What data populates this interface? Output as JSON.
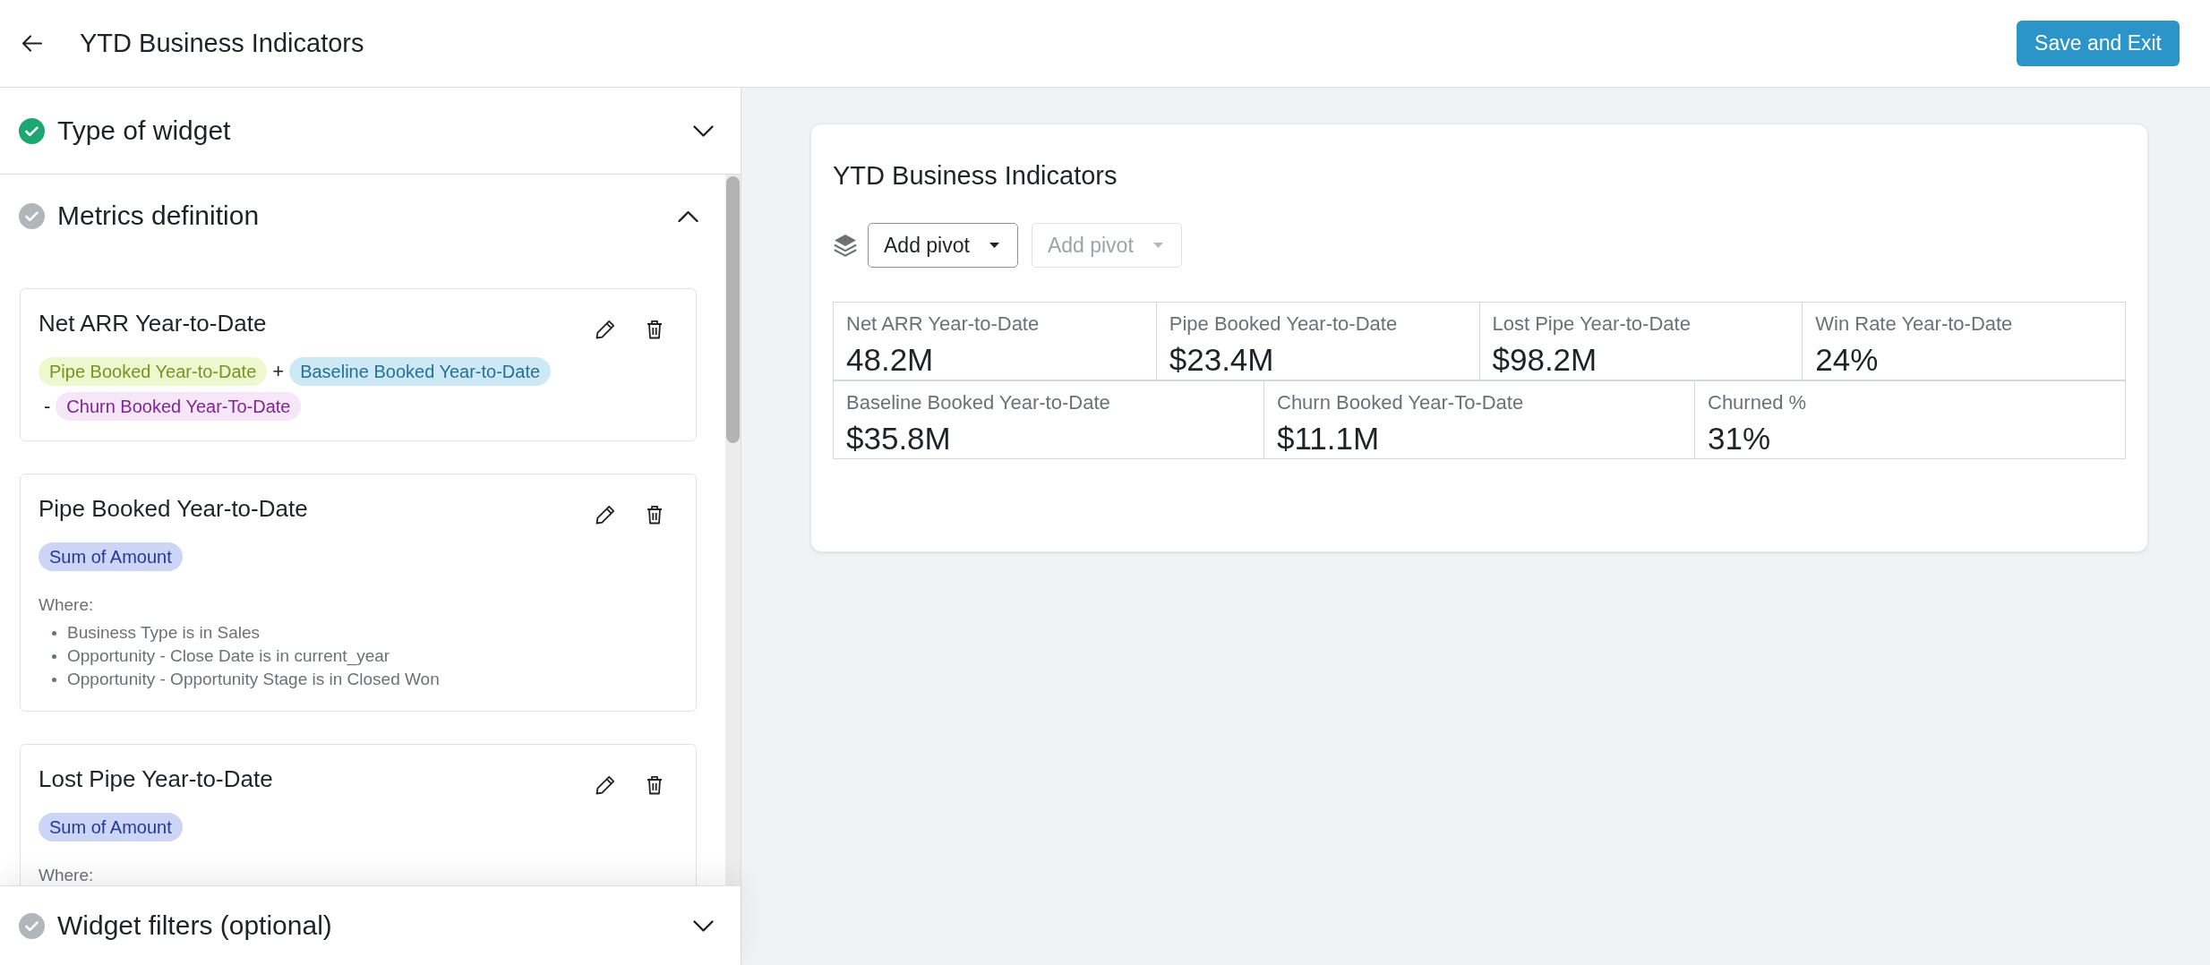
{
  "header": {
    "title": "YTD Business Indicators",
    "save_button": "Save and Exit"
  },
  "sections": [
    {
      "title": "Type of widget",
      "done": true,
      "expanded": false
    },
    {
      "title": "Metrics definition",
      "done": false,
      "expanded": true,
      "metrics": [
        {
          "name": "Net ARR Year-to-Date",
          "terms": [
            {
              "kind": "metric",
              "label": "Pipe Booked Year-to-Date",
              "color": "#eef8cf"
            },
            {
              "kind": "operator",
              "label": "+"
            },
            {
              "kind": "metric",
              "label": "Baseline Booked Year-to-Date",
              "color": "#cde9f6"
            },
            {
              "kind": "operator",
              "label": "-"
            },
            {
              "kind": "metric",
              "label": "Churn Booked Year-To-Date",
              "color": "#f5e6f8"
            }
          ]
        },
        {
          "name": "Pipe Booked Year-to-Date",
          "terms": [
            {
              "kind": "aggregation",
              "label": "Sum of Amount",
              "color": "#cdd5f7"
            }
          ],
          "where": {
            "label": "Where:",
            "conditions": [
              "Business Type is in Sales",
              "Opportunity - Close Date is in current_year",
              "Opportunity - Opportunity Stage is in Closed Won"
            ]
          }
        },
        {
          "name": "Lost Pipe Year-to-Date",
          "terms": [
            {
              "kind": "aggregation",
              "label": "Sum of Amount",
              "color": "#cdd5f7"
            }
          ],
          "where": {
            "label": "Where:"
          }
        }
      ]
    },
    {
      "title": "Widget filters (optional)",
      "done": false,
      "expanded": false
    }
  ],
  "preview": {
    "title": "YTD Business Indicators",
    "pivots": [
      {
        "label": "Add pivot",
        "disabled": false
      },
      {
        "label": "Add pivot",
        "disabled": true
      }
    ],
    "tile_rows": [
      [
        {
          "label": "Net ARR Year-to-Date",
          "value": "48.2M"
        },
        {
          "label": "Pipe Booked Year-to-Date",
          "value": "$23.4M"
        },
        {
          "label": "Lost Pipe Year-to-Date",
          "value": "$98.2M"
        },
        {
          "label": "Win Rate Year-to-Date",
          "value": "24%"
        }
      ],
      [
        {
          "label": "Baseline Booked Year-to-Date",
          "value": "$35.8M"
        },
        {
          "label": "Churn Booked Year-To-Date",
          "value": "$11.1M"
        },
        {
          "label": "Churned %",
          "value": "31%"
        }
      ]
    ]
  }
}
